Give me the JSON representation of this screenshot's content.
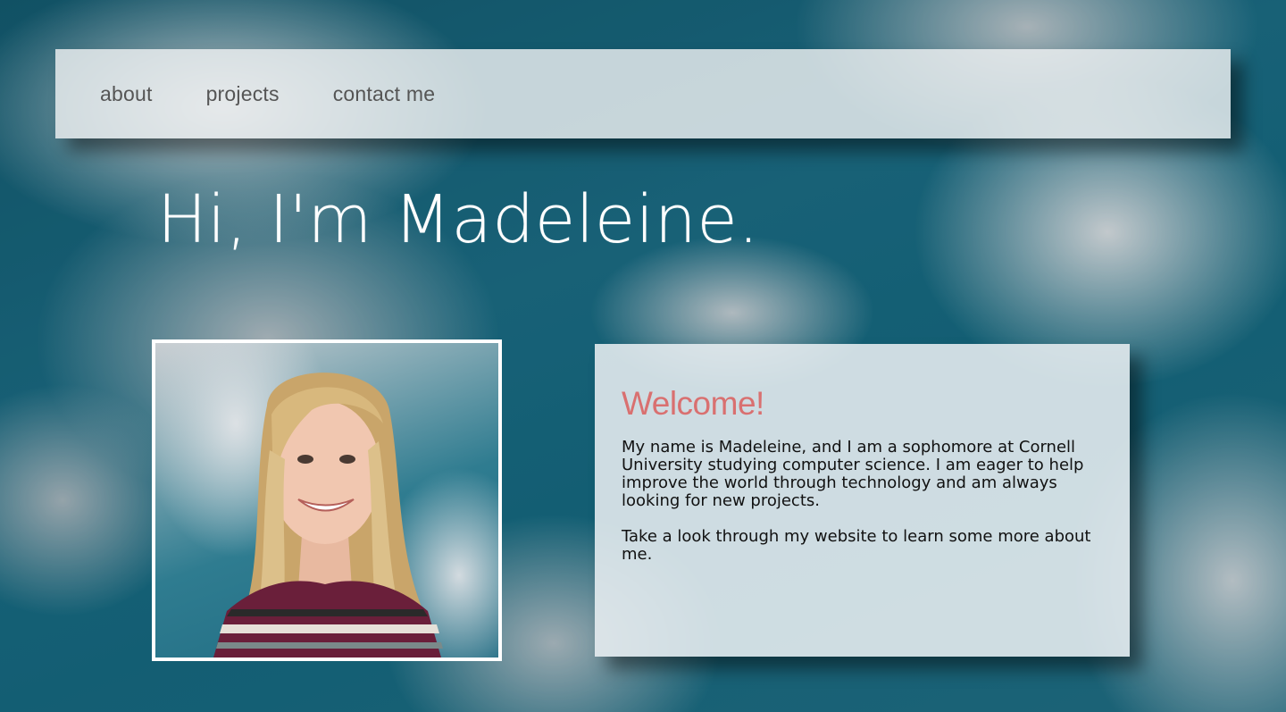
{
  "nav": {
    "items": [
      {
        "label": "about"
      },
      {
        "label": "projects"
      },
      {
        "label": "contact me"
      }
    ]
  },
  "hero": {
    "title": "Hi, I'm Madeleine."
  },
  "welcome": {
    "title": "Welcome!",
    "paragraphs": [
      "My name is Madeleine, and I am a sophomore at Cornell University studying computer science. I am eager to help improve the world through technology and am always looking for new projects.",
      "Take a look through my website to learn some more about me."
    ]
  },
  "colors": {
    "accent": "#d97070",
    "nav_text": "#555555",
    "hero_text": "#ffffff"
  }
}
